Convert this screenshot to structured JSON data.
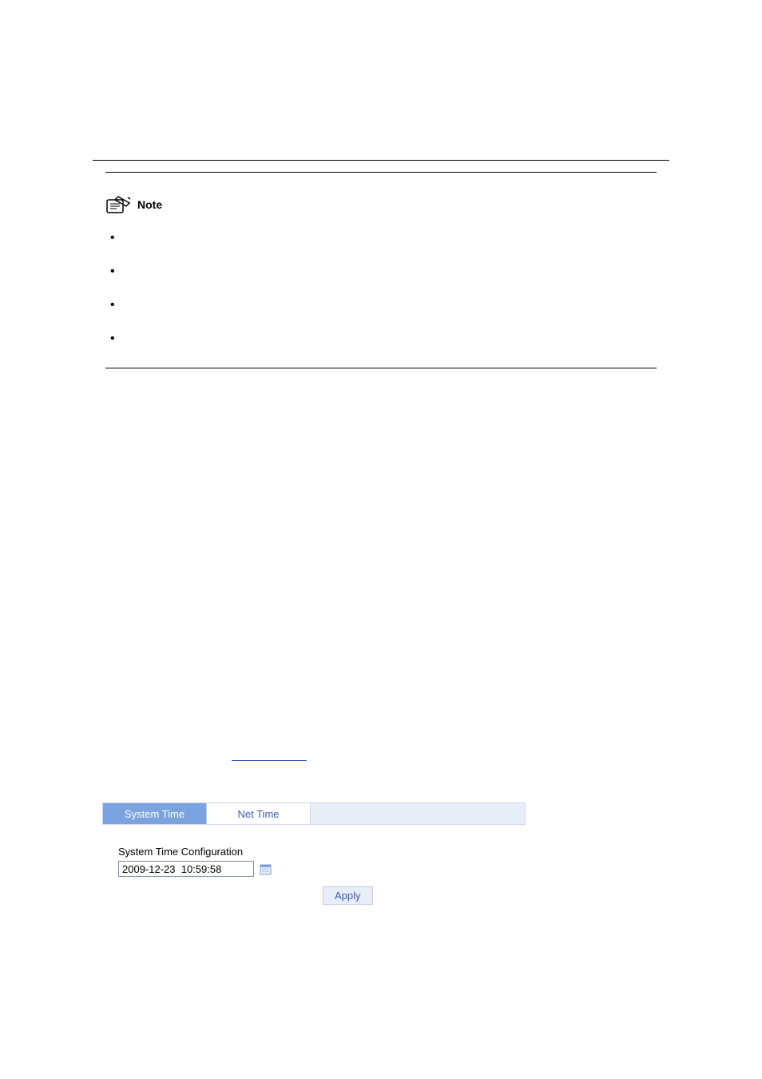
{
  "note": {
    "label": "Note",
    "items": [
      "",
      "",
      "",
      ""
    ]
  },
  "ui": {
    "tabs": {
      "system_time": "System Time",
      "net_time": "Net Time"
    },
    "config": {
      "label": "System Time Configuration",
      "value": "2009-12-23  10:59:58"
    },
    "apply_label": "Apply"
  }
}
